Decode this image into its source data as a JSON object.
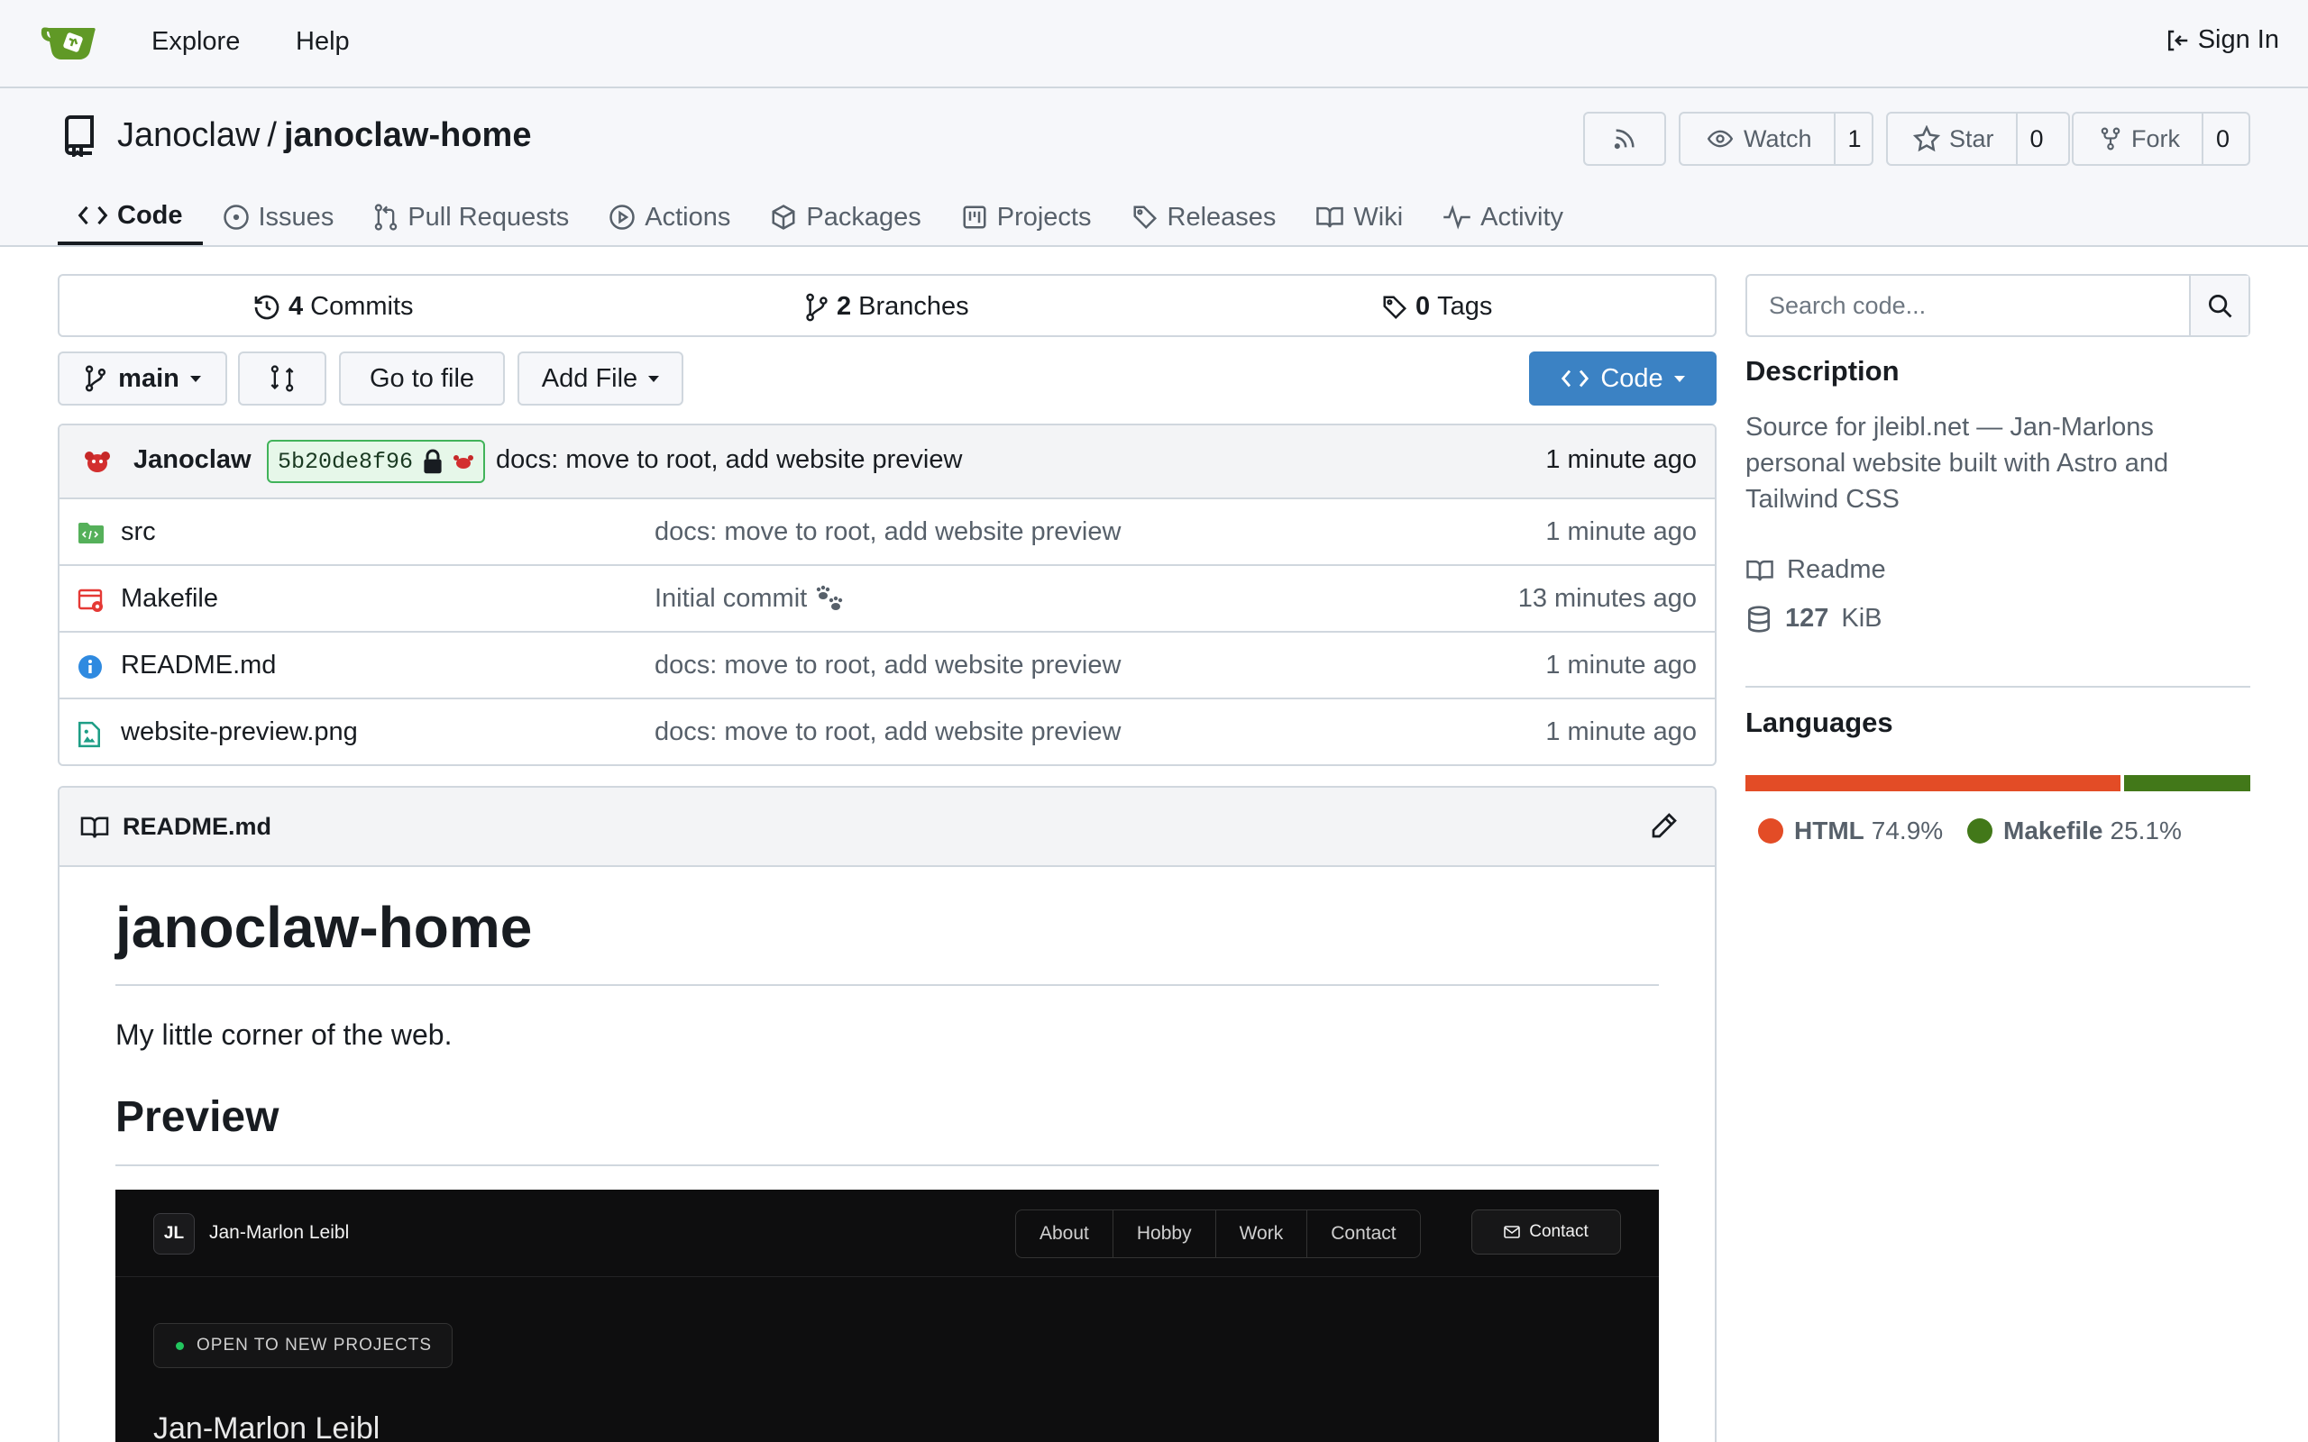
{
  "topnav": {
    "explore": "Explore",
    "help": "Help",
    "sign_in": "Sign In"
  },
  "repo": {
    "owner": "Janoclaw",
    "separator": "/",
    "name": "janoclaw-home",
    "watch_label": "Watch",
    "watch_count": "1",
    "star_label": "Star",
    "star_count": "0",
    "fork_label": "Fork",
    "fork_count": "0"
  },
  "tabs": [
    {
      "label": "Code",
      "icon": "code-icon",
      "active": true
    },
    {
      "label": "Issues",
      "icon": "issue-icon"
    },
    {
      "label": "Pull Requests",
      "icon": "pull-request-icon"
    },
    {
      "label": "Actions",
      "icon": "play-icon"
    },
    {
      "label": "Packages",
      "icon": "package-icon"
    },
    {
      "label": "Projects",
      "icon": "project-icon"
    },
    {
      "label": "Releases",
      "icon": "tag-icon"
    },
    {
      "label": "Wiki",
      "icon": "book-icon"
    },
    {
      "label": "Activity",
      "icon": "pulse-icon"
    }
  ],
  "stats": {
    "commits_count": "4",
    "commits_label": "Commits",
    "branches_count": "2",
    "branches_label": "Branches",
    "tags_count": "0",
    "tags_label": "Tags"
  },
  "toolbar": {
    "branch": "main",
    "go_to_file": "Go to file",
    "add_file": "Add File",
    "code": "Code"
  },
  "latest_commit": {
    "author": "Janoclaw",
    "sha": "5b20de8f96",
    "message": "docs: move to root, add website preview",
    "time": "1 minute ago"
  },
  "files": [
    {
      "name": "src",
      "icon": "folder-icon",
      "message": "docs: move to root, add website preview",
      "time": "1 minute ago"
    },
    {
      "name": "Makefile",
      "icon": "makefile-icon",
      "message": "Initial commit",
      "emoji": "paw-prints-icon",
      "time": "13 minutes ago"
    },
    {
      "name": "README.md",
      "icon": "info-icon",
      "message": "docs: move to root, add website preview",
      "time": "1 minute ago"
    },
    {
      "name": "website-preview.png",
      "icon": "image-file-icon",
      "message": "docs: move to root, add website preview",
      "time": "1 minute ago"
    }
  ],
  "readme": {
    "file": "README.md",
    "h1": "janoclaw-home",
    "intro": "My little corner of the web.",
    "h2": "Preview",
    "preview": {
      "logo": "JL",
      "name": "Jan-Marlon Leibl",
      "nav": [
        "About",
        "Hobby",
        "Work",
        "Contact"
      ],
      "contact": "Contact",
      "badge": "OPEN TO NEW PROJECTS",
      "hero": "Jan-Marlon Leibl"
    }
  },
  "sidebar": {
    "search_placeholder": "Search code...",
    "description_title": "Description",
    "description": "Source for jleibl.net — Jan-Marlons personal website built with Astro and Tailwind CSS",
    "readme": "Readme",
    "size_value": "127",
    "size_unit": "KiB",
    "languages_title": "Languages",
    "languages": [
      {
        "name": "HTML",
        "percent": "74.9%",
        "color": "#e34c26",
        "share": 0.749
      },
      {
        "name": "Makefile",
        "percent": "25.1%",
        "color": "#427819",
        "share": 0.251
      }
    ]
  },
  "colors": {
    "accent": "#3b82c4",
    "border": "#d0d7de",
    "logo_green": "#609926"
  }
}
